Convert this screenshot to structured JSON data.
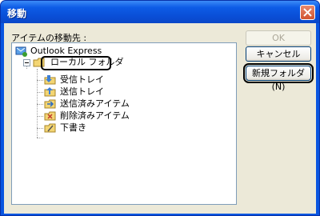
{
  "window": {
    "title": "移動"
  },
  "prompt": "アイテムの移動先 :",
  "tree": {
    "root": "Outlook Express",
    "local": "ローカル フォルダ",
    "children": [
      "受信トレイ",
      "送信トレイ",
      "送信済みアイテム",
      "削除済みアイテム",
      "下書き"
    ]
  },
  "buttons": {
    "ok": "OK",
    "cancel": "キャンセル",
    "new_folder": "新規フォルダ(N)"
  }
}
